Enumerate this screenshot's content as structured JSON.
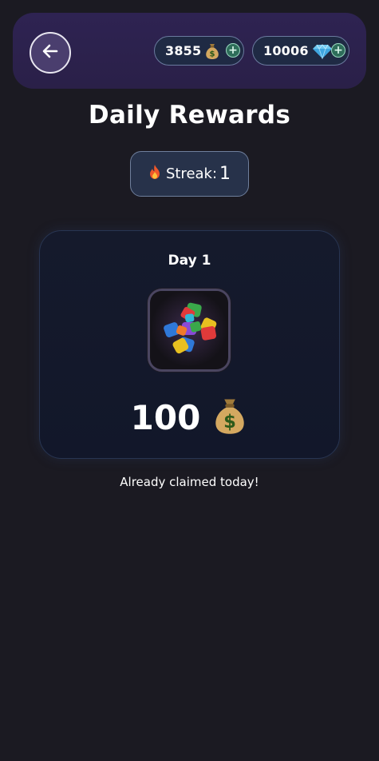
{
  "header": {
    "back_icon": "arrow-left-icon",
    "coins": {
      "value": "3855",
      "icon": "money-bag-icon"
    },
    "gems": {
      "value": "10006",
      "icon": "diamond-icon"
    },
    "add_icon": "plus-icon"
  },
  "title": "Daily Rewards",
  "streak": {
    "icon": "fire-icon",
    "label": "Streak:",
    "count": "1"
  },
  "reward_card": {
    "day_label": "Day 1",
    "prize_icon": "colorful-cube-cluster-icon",
    "amount": "100",
    "amount_icon": "money-bag-icon"
  },
  "status_text": "Already claimed today!",
  "colors": {
    "background": "#1b1a22",
    "topbar": "#2e2352",
    "pill": "#1f2a44",
    "card": "#151a2c"
  }
}
